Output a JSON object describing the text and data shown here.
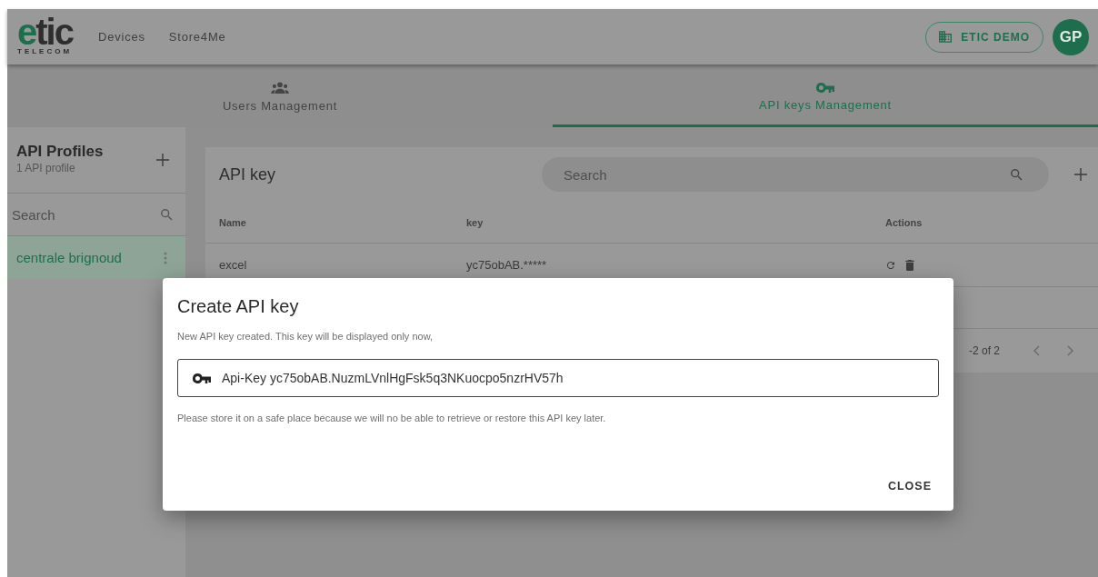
{
  "header": {
    "logo": {
      "name": "etic",
      "tagline": "TELECOM"
    },
    "nav": [
      {
        "label": "Devices"
      },
      {
        "label": "Store4Me"
      }
    ],
    "organization": "ETIC DEMO",
    "avatar": "GP"
  },
  "tabs": [
    {
      "label": "Users Management",
      "selected": false
    },
    {
      "label": "API keys Management",
      "selected": true
    }
  ],
  "sidebar": {
    "title": "API Profiles",
    "subtitle": "1 API profile",
    "search": {
      "placeholder": "Search"
    },
    "items": [
      {
        "label": "centrale brignoud",
        "selected": true
      }
    ]
  },
  "api_keys": {
    "title": "API key",
    "search": {
      "placeholder": "Search"
    },
    "table": {
      "columns": [
        "Name",
        "key",
        "Actions"
      ],
      "rows": [
        {
          "name": "excel",
          "key": "yc75obAB.*****"
        }
      ]
    },
    "pagination": {
      "range": "-2 of 2"
    }
  },
  "dialog": {
    "title": "Create API key",
    "message": "New API key created. This key will be displayed only now,",
    "key_field": {
      "value": "Api-Key yc75obAB.NuzmLVnlHgFsk5q3NKuocpo5nzrHV57h"
    },
    "note": "Please store it on a safe place because we will no be able to retrieve or restore this API key later.",
    "buttons": [
      {
        "label": "CLOSE"
      }
    ]
  }
}
